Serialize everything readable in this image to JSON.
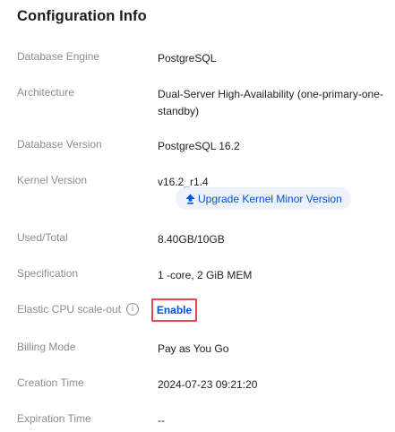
{
  "title": "Configuration Info",
  "rows": {
    "db_engine": {
      "label": "Database Engine",
      "value": "PostgreSQL"
    },
    "architecture": {
      "label": "Architecture",
      "value_line1": "Dual-Server High-Availability (one-primary-one-",
      "value_line2": "standby)"
    },
    "db_version": {
      "label": "Database Version",
      "value": "PostgreSQL 16.2"
    },
    "kernel_version": {
      "label": "Kernel Version",
      "value": "v16.2_r1.4",
      "upgrade_label": "Upgrade Kernel Minor Version"
    },
    "used_total": {
      "label": "Used/Total",
      "value": "8.40GB/10GB"
    },
    "specification": {
      "label": "Specification",
      "value": "1 -core, 2 GiB MEM"
    },
    "elastic_cpu": {
      "label": "Elastic CPU scale-out",
      "info_glyph": "i",
      "action_label": "Enable"
    },
    "billing_mode": {
      "label": "Billing Mode",
      "value": "Pay as You Go"
    },
    "creation_time": {
      "label": "Creation Time",
      "value": "2024-07-23 09:21:20"
    },
    "expiration_time": {
      "label": "Expiration Time",
      "value": "--"
    }
  },
  "colors": {
    "accent": "#0052d9",
    "highlight": "#e5484d",
    "label": "#8c8c8c"
  },
  "icons": {
    "upgrade": "upload-arrow-icon",
    "info": "info-circle-icon"
  }
}
